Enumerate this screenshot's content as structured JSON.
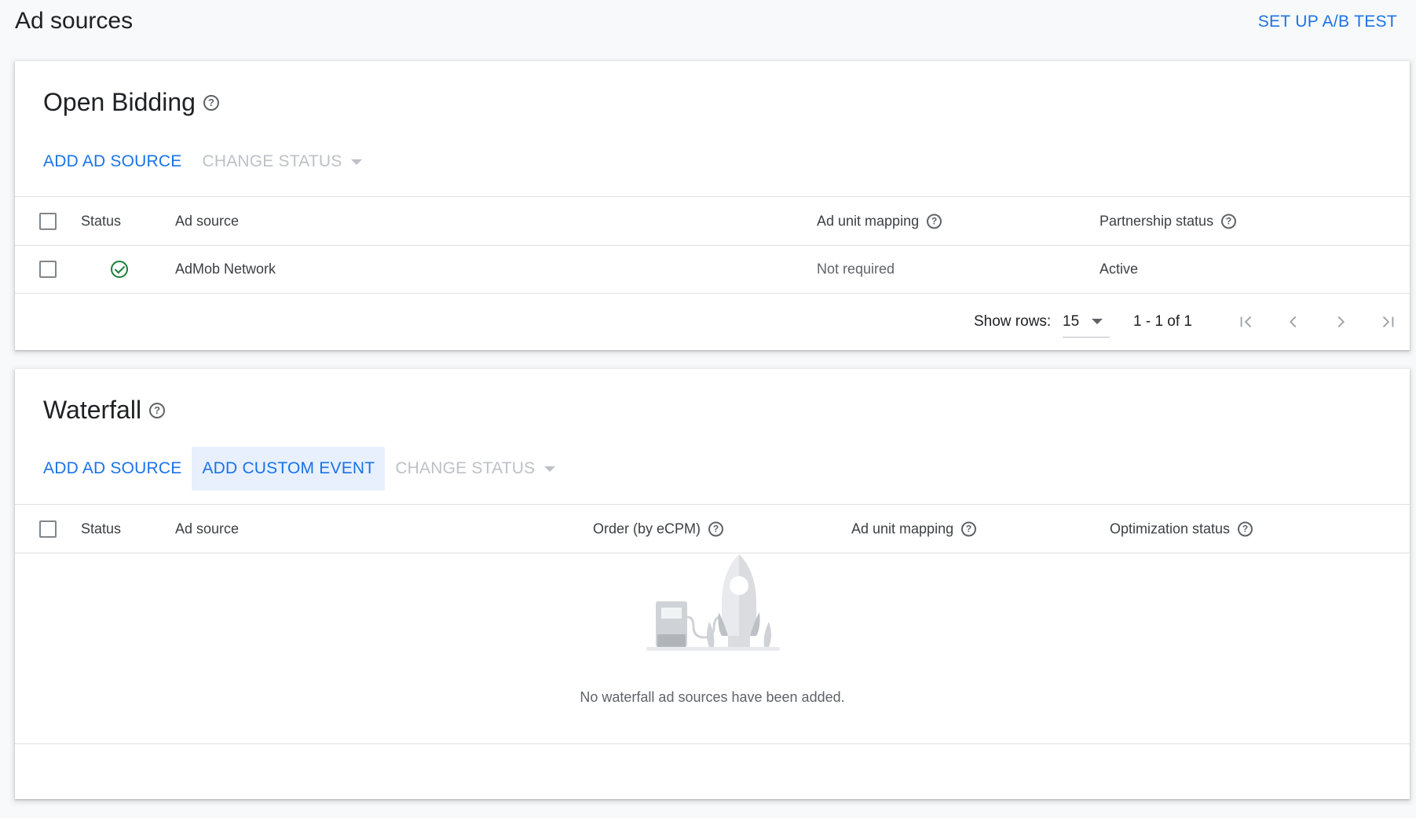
{
  "page": {
    "title": "Ad sources",
    "ab_test_label": "SET UP A/B TEST"
  },
  "bidding": {
    "title": "Open Bidding",
    "toolbar": {
      "add_ad_source": "ADD AD SOURCE",
      "change_status": "CHANGE STATUS"
    },
    "columns": {
      "status": "Status",
      "ad_source": "Ad source",
      "ad_unit_mapping": "Ad unit mapping",
      "partnership_status": "Partnership status"
    },
    "rows": [
      {
        "status": "active-check-icon",
        "ad_source": "AdMob Network",
        "ad_unit_mapping": "Not required",
        "partnership_status": "Active"
      }
    ],
    "pager": {
      "show_rows_label": "Show rows:",
      "rows_per_page": "15",
      "range": "1 - 1 of 1"
    }
  },
  "waterfall": {
    "title": "Waterfall",
    "toolbar": {
      "add_ad_source": "ADD AD SOURCE",
      "add_custom_event": "ADD CUSTOM EVENT",
      "change_status": "CHANGE STATUS"
    },
    "columns": {
      "status": "Status",
      "ad_source": "Ad source",
      "order": "Order (by eCPM)",
      "ad_unit_mapping": "Ad unit mapping",
      "optimization_status": "Optimization status"
    },
    "empty_message": "No waterfall ad sources have been added."
  },
  "colors": {
    "accent": "#1a73e8",
    "disabled": "#bdc1c6",
    "success": "#188038",
    "highlight_bg": "#e8f0fe"
  }
}
